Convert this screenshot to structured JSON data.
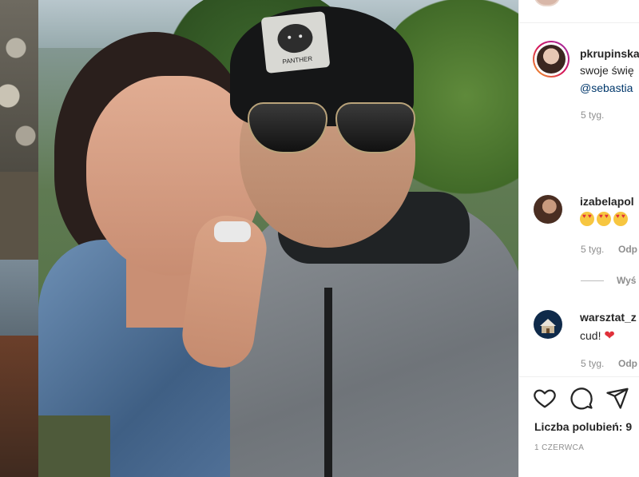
{
  "post": {
    "author": "pkrupinska",
    "caption_line1": "swoje świę",
    "caption_mention": "@sebastia",
    "time_ago": "5 tyg."
  },
  "comments": [
    {
      "username": "izabelapol",
      "time_ago": "5 tyg.",
      "reply_label": "Odp",
      "view_replies": "Wyś"
    },
    {
      "username": "warsztat_z",
      "text": "cud!",
      "time_ago": "5 tyg.",
      "reply_label": "Odp"
    }
  ],
  "icons": {
    "like": "heart-outline-icon",
    "comment": "comment-bubble-icon",
    "share": "paper-plane-icon"
  },
  "likes_label": "Liczba polubień: 9",
  "post_date": "1 CZERWCA",
  "photo_text": {
    "cap_patch": "PANTHER"
  },
  "colors": {
    "link": "#00376b",
    "text": "#262626",
    "muted": "#8e8e8e",
    "heart": "#e0303a"
  }
}
